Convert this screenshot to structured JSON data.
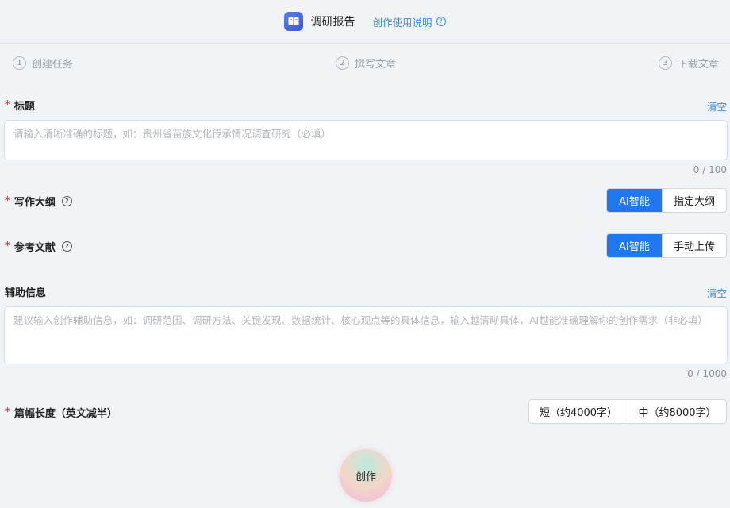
{
  "header": {
    "app_icon": "book-icon",
    "title": "调研报告",
    "guide_link": "创作使用说明",
    "guide_icon": "help-circle-icon"
  },
  "steps": [
    {
      "num": "1",
      "label": "创建任务"
    },
    {
      "num": "2",
      "label": "撰写文章"
    },
    {
      "num": "3",
      "label": "下载文章"
    }
  ],
  "title_field": {
    "label": "标题",
    "required_mark": "*",
    "clear": "清空",
    "placeholder": "请输入清晰准确的标题，如：贵州省苗族文化传承情况调查研究（必填）",
    "counter": "0 / 100"
  },
  "outline": {
    "label": "写作大纲",
    "required_mark": "*",
    "options": [
      "AI智能",
      "指定大纲"
    ],
    "selected": "AI智能"
  },
  "references": {
    "label": "参考文献",
    "required_mark": "*",
    "options": [
      "AI智能",
      "手动上传"
    ],
    "selected": "AI智能"
  },
  "aux_info": {
    "label": "辅助信息",
    "clear": "清空",
    "placeholder": "建议输入创作辅助信息，如：调研范围、调研方法、关键发现、数据统计、核心观点等的具体信息，输入越清晰具体，AI越能准确理解你的创作需求（非必填）",
    "counter": "0 / 1000"
  },
  "length": {
    "label": "篇幅长度（英文减半）",
    "required_mark": "*",
    "options": [
      "短（约4000字）",
      "中（约8000字）"
    ]
  },
  "create_button": "创作",
  "colors": {
    "accent": "#1f78f0",
    "link": "#3a8bd8",
    "required": "#e23b3b",
    "background": "#f0f4f7"
  }
}
